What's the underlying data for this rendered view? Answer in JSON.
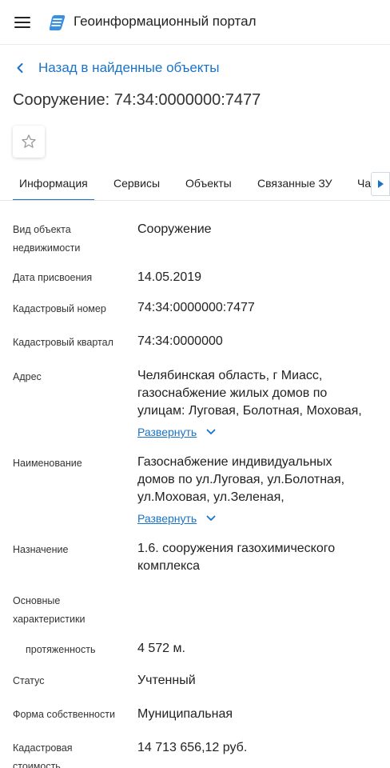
{
  "header": {
    "app_title": "Геоинформационный портал"
  },
  "back_link": {
    "label": "Назад в найденные объекты"
  },
  "page_title": "Сооружение: 74:34:0000000:7477",
  "tabs": [
    {
      "label": "Информация",
      "active": true
    },
    {
      "label": "Сервисы"
    },
    {
      "label": "Объекты"
    },
    {
      "label": "Связанные ЗУ"
    },
    {
      "label": "Ча"
    }
  ],
  "fields": {
    "type": {
      "label_lines": [
        "Вид объекта",
        "недвижимости"
      ],
      "value": "Сооружение"
    },
    "date": {
      "label": "Дата присвоения",
      "value": "14.05.2019"
    },
    "cad_number": {
      "label": "Кадастровый номер",
      "value": "74:34:0000000:7477"
    },
    "cad_quarter": {
      "label": "Кадастровый квартал",
      "value": "74:34:0000000"
    },
    "address": {
      "label": "Адрес",
      "value_lines": [
        "Челябинская область, г Миасс,",
        "газоснабжение жилых домов по",
        "улицам: Луговая, Болотная, Моховая,"
      ],
      "expand": "Развернуть"
    },
    "name": {
      "label": "Наименование",
      "value_lines": [
        "Газоснабжение индивидуальных",
        "домов по ул.Луговая, ул.Болотная,",
        "ул.Моховая, ул.Зеленая,"
      ],
      "expand": "Развернуть"
    },
    "purpose": {
      "label": "Назначение",
      "value_lines": [
        "1.6. сооружения газохимического",
        "комплекса"
      ]
    },
    "main_chars": {
      "label_lines": [
        "Основные",
        "характеристики"
      ]
    },
    "length": {
      "label": "протяженность",
      "value": "4 572 м."
    },
    "status": {
      "label": "Статус",
      "value": "Учтенный"
    },
    "ownership": {
      "label": "Форма собственности",
      "value": "Муниципальная"
    },
    "cad_cost": {
      "label_lines": [
        "Кадастровая",
        "стоимость"
      ],
      "value": "14 713 656,12 руб."
    }
  },
  "colors": {
    "accent": "#1a73c8",
    "text": "#222222"
  },
  "icons": {
    "menu": "hamburger-icon",
    "logo": "portal-logo",
    "back": "chevron-left-icon",
    "favorite": "star-outline-icon",
    "expand": "chevron-down-icon",
    "tabs_scroll": "triangle-right-icon"
  }
}
